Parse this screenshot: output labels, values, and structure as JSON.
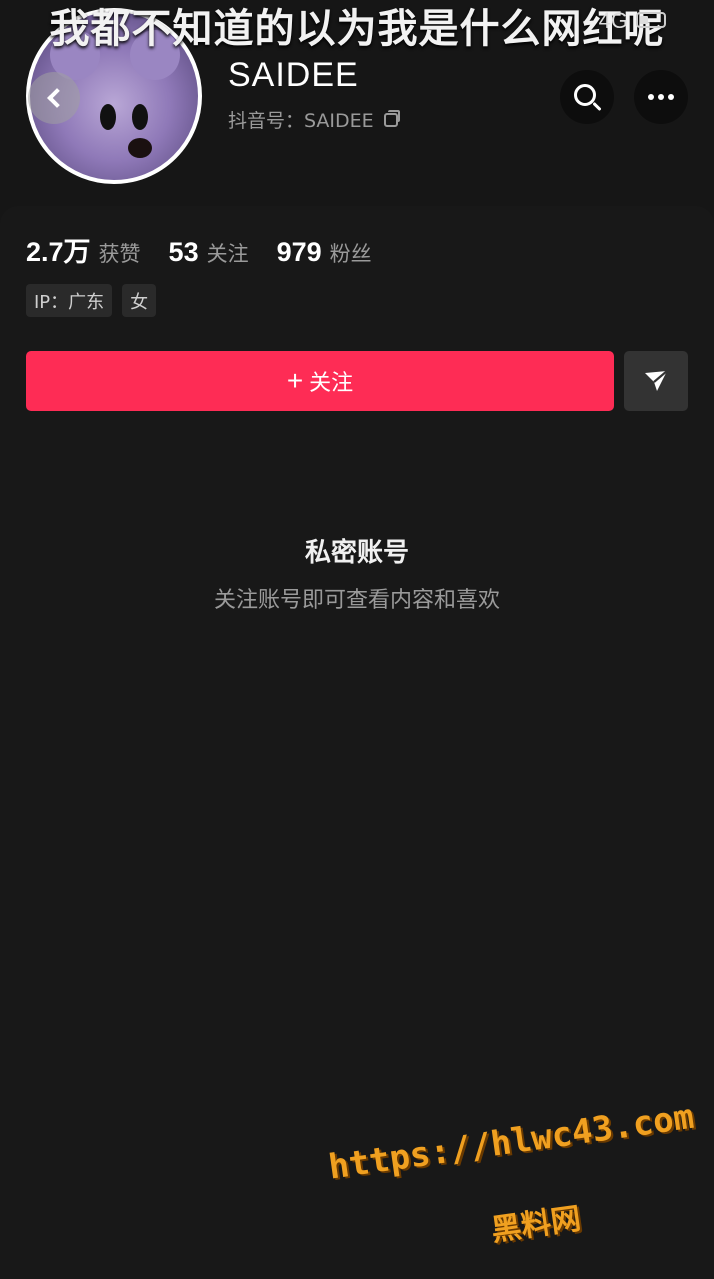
{
  "overlay": {
    "caption": "我都不知道的以为我是什么网红呢"
  },
  "status_bar": {
    "network": "4G"
  },
  "profile": {
    "username": "SAIDEE",
    "douyin_id_label": "抖音号：SAIDEE"
  },
  "stats": [
    {
      "value": "2.7万",
      "label": "获赞"
    },
    {
      "value": "53",
      "label": "关注"
    },
    {
      "value": "979",
      "label": "粉丝"
    }
  ],
  "tags": [
    "IP：广东",
    "女"
  ],
  "actions": {
    "follow_label": "关注",
    "follow_plus": "+"
  },
  "private_notice": {
    "title": "私密账号",
    "subtitle": "关注账号即可查看内容和喜欢"
  },
  "watermark": {
    "url": "https://hlwc43.com",
    "name": "黑料网"
  },
  "colors": {
    "accent": "#fe2c55",
    "background": "#161616",
    "watermark": "#f0a020"
  },
  "icons": [
    "back-icon",
    "search-icon",
    "more-icon",
    "copy-icon",
    "share-icon"
  ]
}
